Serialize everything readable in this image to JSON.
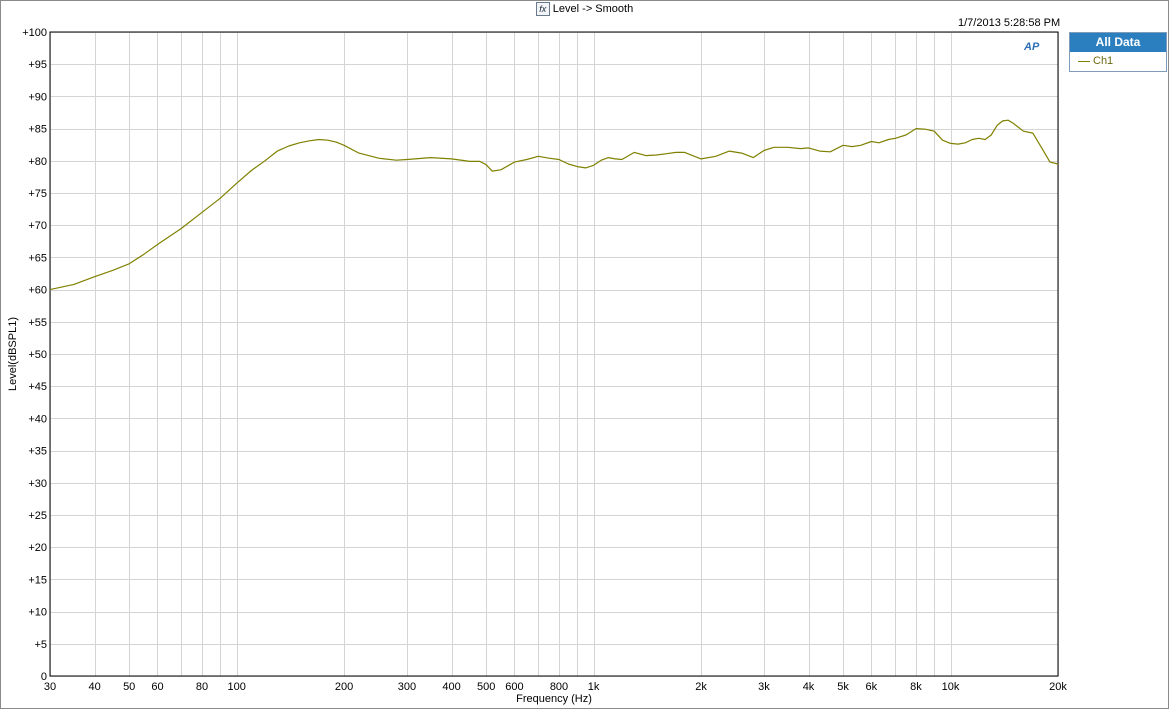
{
  "window": {
    "title": "Level -> Smooth",
    "title_icon": "fx-icon",
    "timestamp": "1/7/2013 5:28:58 PM",
    "logo_text": "AP"
  },
  "legend": {
    "header": "All Data",
    "items": [
      {
        "label": "Ch1",
        "color": "#808000"
      }
    ]
  },
  "chart_data": {
    "type": "line",
    "title": "Level -> Smooth",
    "xlabel": "Frequency (Hz)",
    "ylabel": "Level(dBSPL1)",
    "x_scale": "log",
    "xlim": [
      30,
      20000
    ],
    "ylim": [
      0,
      100
    ],
    "grid": true,
    "legend_position": "right",
    "x_tick_labels": [
      {
        "value": 30,
        "label": "30"
      },
      {
        "value": 40,
        "label": "40"
      },
      {
        "value": 50,
        "label": "50"
      },
      {
        "value": 60,
        "label": "60"
      },
      {
        "value": 80,
        "label": "80"
      },
      {
        "value": 100,
        "label": "100"
      },
      {
        "value": 200,
        "label": "200"
      },
      {
        "value": 300,
        "label": "300"
      },
      {
        "value": 400,
        "label": "400"
      },
      {
        "value": 500,
        "label": "500"
      },
      {
        "value": 600,
        "label": "600"
      },
      {
        "value": 800,
        "label": "800"
      },
      {
        "value": 1000,
        "label": "1k"
      },
      {
        "value": 2000,
        "label": "2k"
      },
      {
        "value": 3000,
        "label": "3k"
      },
      {
        "value": 4000,
        "label": "4k"
      },
      {
        "value": 5000,
        "label": "5k"
      },
      {
        "value": 6000,
        "label": "6k"
      },
      {
        "value": 8000,
        "label": "8k"
      },
      {
        "value": 10000,
        "label": "10k"
      },
      {
        "value": 20000,
        "label": "20k"
      }
    ],
    "x_grid_values": [
      30,
      40,
      50,
      60,
      70,
      80,
      90,
      100,
      200,
      300,
      400,
      500,
      600,
      700,
      800,
      900,
      1000,
      2000,
      3000,
      4000,
      5000,
      6000,
      7000,
      8000,
      9000,
      10000,
      20000
    ],
    "y_ticks": [
      0,
      5,
      10,
      15,
      20,
      25,
      30,
      35,
      40,
      45,
      50,
      55,
      60,
      65,
      70,
      75,
      80,
      85,
      90,
      95,
      100
    ],
    "y_tick_labels": [
      "0",
      "+5",
      "+10",
      "+15",
      "+20",
      "+25",
      "+30",
      "+35",
      "+40",
      "+45",
      "+50",
      "+55",
      "+60",
      "+65",
      "+70",
      "+75",
      "+80",
      "+85",
      "+90",
      "+95",
      "+100"
    ],
    "series": [
      {
        "name": "Ch1",
        "color": "#808000",
        "x": [
          30,
          35,
          40,
          45,
          50,
          55,
          60,
          70,
          80,
          90,
          100,
          110,
          120,
          130,
          140,
          150,
          160,
          170,
          180,
          190,
          200,
          220,
          250,
          280,
          300,
          350,
          400,
          450,
          480,
          500,
          520,
          550,
          600,
          650,
          700,
          750,
          800,
          850,
          900,
          950,
          1000,
          1050,
          1100,
          1150,
          1200,
          1300,
          1400,
          1500,
          1600,
          1700,
          1800,
          2000,
          2200,
          2400,
          2600,
          2800,
          3000,
          3200,
          3500,
          3800,
          4000,
          4300,
          4600,
          5000,
          5300,
          5600,
          6000,
          6300,
          6700,
          7000,
          7500,
          8000,
          8500,
          9000,
          9500,
          10000,
          10500,
          11000,
          11500,
          12000,
          12500,
          13000,
          13500,
          14000,
          14500,
          15000,
          16000,
          17000,
          18000,
          19000,
          20000
        ],
        "y": [
          60,
          60.8,
          62,
          63,
          64,
          65.5,
          67,
          69.5,
          72,
          74.2,
          76.5,
          78.5,
          80,
          81.5,
          82.3,
          82.8,
          83.1,
          83.3,
          83.2,
          82.9,
          82.4,
          81.2,
          80.4,
          80.1,
          80.2,
          80.5,
          80.3,
          79.9,
          79.9,
          79.4,
          78.4,
          78.6,
          79.8,
          80.2,
          80.7,
          80.4,
          80.2,
          79.5,
          79.1,
          78.9,
          79.3,
          80.1,
          80.5,
          80.3,
          80.2,
          81.3,
          80.8,
          80.9,
          81.1,
          81.3,
          81.3,
          80.3,
          80.7,
          81.5,
          81.2,
          80.5,
          81.6,
          82.1,
          82.1,
          81.9,
          82,
          81.5,
          81.4,
          82.4,
          82.2,
          82.4,
          83,
          82.8,
          83.3,
          83.5,
          84,
          85,
          84.9,
          84.6,
          83.2,
          82.7,
          82.6,
          82.8,
          83.3,
          83.5,
          83.3,
          84,
          85.5,
          86.2,
          86.3,
          85.8,
          84.6,
          84.3,
          82,
          79.8,
          79.5
        ]
      }
    ]
  }
}
